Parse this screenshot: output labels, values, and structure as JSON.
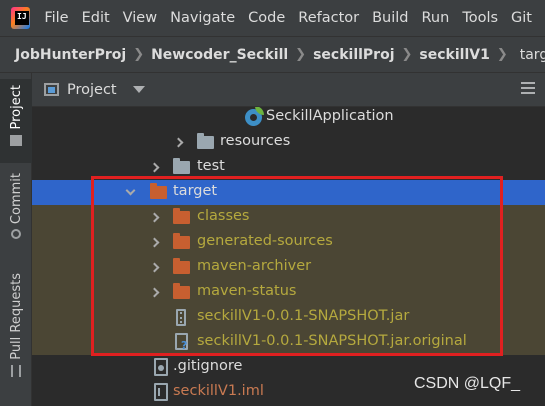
{
  "menu": [
    "File",
    "Edit",
    "View",
    "Navigate",
    "Code",
    "Refactor",
    "Build",
    "Run",
    "Tools",
    "Git"
  ],
  "breadcrumb": [
    "JobHunterProj",
    "Newcoder_Seckill",
    "seckillProj",
    "seckillV1",
    "target"
  ],
  "tool_windows": {
    "project": "Project",
    "commit": "Commit",
    "pull_requests": "Pull Requests"
  },
  "panel": {
    "title": "Project"
  },
  "tree": {
    "seckill_application": "SeckillApplication",
    "resources": "resources",
    "test": "test",
    "target": "target",
    "classes": "classes",
    "generated_sources": "generated-sources",
    "maven_archiver": "maven-archiver",
    "maven_status": "maven-status",
    "jar": "seckillV1-0.0.1-SNAPSHOT.jar",
    "jar_original": "seckillV1-0.0.1-SNAPSHOT.jar.original",
    "gitignore": ".gitignore",
    "iml": "seckillV1.iml"
  },
  "watermark": "CSDN @LQF_",
  "colors": {
    "selection": "#2f65ca",
    "excluded_folder_bg": "#4b4634",
    "excluded_text": "#b5a93e",
    "highlight_border": "#e02020",
    "folder_orange": "#c75f30"
  }
}
